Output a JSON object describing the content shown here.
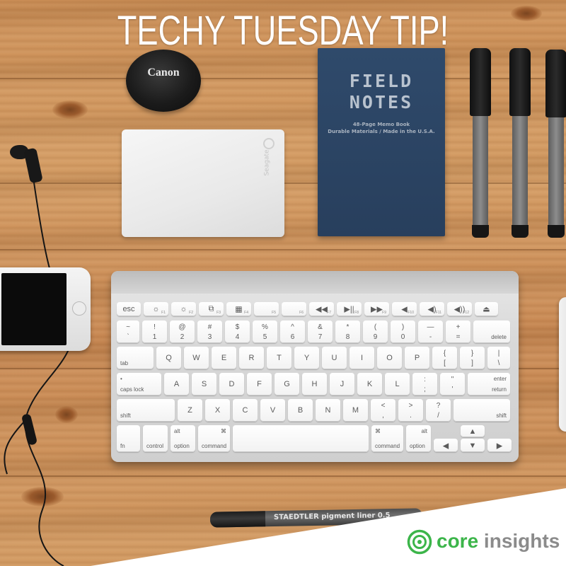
{
  "headline": "TECHY TUESDAY TIP!",
  "lens_cap": {
    "brand": "Canon"
  },
  "hard_drive": {
    "logo_text": "Seagate"
  },
  "notebook": {
    "title": "FIELD\nNOTES",
    "subtitle": "48-Page Memo Book\nDurable Materials / Made in the U.S.A."
  },
  "staedtler": {
    "text": "STAEDTLER  pigment liner  0.5"
  },
  "brand": {
    "word1": "core",
    "word2": " insights",
    "accent_color": "#3cb54a",
    "gray_color": "#8b8b8b"
  },
  "keyboard": {
    "fn_row": [
      {
        "name": "esc",
        "mid": "esc",
        "w": 34
      },
      {
        "name": "f1",
        "mid": "☼",
        "fn": "F1",
        "w": 35
      },
      {
        "name": "f2",
        "mid": "☼",
        "fn": "F2",
        "w": 35
      },
      {
        "name": "f3",
        "mid": "⧉",
        "fn": "F3",
        "w": 35
      },
      {
        "name": "f4",
        "mid": "▦",
        "fn": "F4",
        "w": 35
      },
      {
        "name": "f5",
        "mid": "",
        "fn": "F5",
        "w": 35
      },
      {
        "name": "f6",
        "mid": "",
        "fn": "F6",
        "w": 35
      },
      {
        "name": "f7",
        "mid": "◀◀",
        "fn": "F7",
        "w": 35
      },
      {
        "name": "f8",
        "mid": "▶||",
        "fn": "F8",
        "w": 35
      },
      {
        "name": "f9",
        "mid": "▶▶",
        "fn": "F9",
        "w": 35
      },
      {
        "name": "f10",
        "mid": "◀",
        "fn": "F10",
        "w": 35
      },
      {
        "name": "f11",
        "mid": "◀)",
        "fn": "F11",
        "w": 35
      },
      {
        "name": "f12",
        "mid": "◀))",
        "fn": "F12",
        "w": 35
      },
      {
        "name": "eject",
        "mid": "⏏",
        "w": 33
      }
    ],
    "num_row": [
      {
        "name": "tilde",
        "t": "~",
        "b": "`",
        "w": 32
      },
      {
        "name": "1",
        "t": "!",
        "b": "1",
        "w": 35
      },
      {
        "name": "2",
        "t": "@",
        "b": "2",
        "w": 35
      },
      {
        "name": "3",
        "t": "#",
        "b": "3",
        "w": 35
      },
      {
        "name": "4",
        "t": "$",
        "b": "4",
        "w": 35
      },
      {
        "name": "5",
        "t": "%",
        "b": "5",
        "w": 35
      },
      {
        "name": "6",
        "t": "^",
        "b": "6",
        "w": 35
      },
      {
        "name": "7",
        "t": "&",
        "b": "7",
        "w": 35
      },
      {
        "name": "8",
        "t": "*",
        "b": "8",
        "w": 35
      },
      {
        "name": "9",
        "t": "(",
        "b": "9",
        "w": 35
      },
      {
        "name": "0",
        "t": ")",
        "b": "0",
        "w": 35
      },
      {
        "name": "minus",
        "t": "—",
        "b": "-",
        "w": 35
      },
      {
        "name": "equals",
        "t": "+",
        "b": "=",
        "w": 35
      },
      {
        "name": "delete",
        "br": "delete",
        "w": 52
      }
    ],
    "qwerty_row": [
      {
        "name": "tab",
        "bl": "tab",
        "w": 52
      },
      {
        "name": "q",
        "mid": "Q",
        "w": 35
      },
      {
        "name": "w",
        "mid": "W",
        "w": 35
      },
      {
        "name": "e",
        "mid": "E",
        "w": 35
      },
      {
        "name": "r",
        "mid": "R",
        "w": 35
      },
      {
        "name": "t",
        "mid": "T",
        "w": 35
      },
      {
        "name": "y",
        "mid": "Y",
        "w": 35
      },
      {
        "name": "u",
        "mid": "U",
        "w": 35
      },
      {
        "name": "i",
        "mid": "I",
        "w": 35
      },
      {
        "name": "o",
        "mid": "O",
        "w": 35
      },
      {
        "name": "p",
        "mid": "P",
        "w": 35
      },
      {
        "name": "lbracket",
        "t": "{",
        "b": "[",
        "w": 35
      },
      {
        "name": "rbracket",
        "t": "}",
        "b": "]",
        "w": 35
      },
      {
        "name": "backslash",
        "t": "|",
        "b": "\\",
        "w": 32
      }
    ],
    "home_row": [
      {
        "name": "caps-lock",
        "bl": "caps lock",
        "tl": "•",
        "w": 63
      },
      {
        "name": "a",
        "mid": "A",
        "w": 35
      },
      {
        "name": "s",
        "mid": "S",
        "w": 35
      },
      {
        "name": "d",
        "mid": "D",
        "w": 35
      },
      {
        "name": "f",
        "mid": "F",
        "w": 35
      },
      {
        "name": "g",
        "mid": "G",
        "w": 35
      },
      {
        "name": "h",
        "mid": "H",
        "w": 35
      },
      {
        "name": "j",
        "mid": "J",
        "w": 35
      },
      {
        "name": "k",
        "mid": "K",
        "w": 35
      },
      {
        "name": "l",
        "mid": "L",
        "w": 35
      },
      {
        "name": "semicolon",
        "t": ":",
        "b": ";",
        "w": 35
      },
      {
        "name": "quote",
        "t": "\"",
        "b": "'",
        "w": 35
      },
      {
        "name": "return",
        "tr": "enter",
        "br": "return",
        "w": 60
      }
    ],
    "shift_row": [
      {
        "name": "left-shift",
        "bl": "shift",
        "w": 82
      },
      {
        "name": "z",
        "mid": "Z",
        "w": 35
      },
      {
        "name": "x",
        "mid": "X",
        "w": 35
      },
      {
        "name": "c",
        "mid": "C",
        "w": 35
      },
      {
        "name": "v",
        "mid": "V",
        "w": 35
      },
      {
        "name": "b",
        "mid": "B",
        "w": 35
      },
      {
        "name": "n",
        "mid": "N",
        "w": 35
      },
      {
        "name": "m",
        "mid": "M",
        "w": 35
      },
      {
        "name": "comma",
        "t": "<",
        "b": ",",
        "w": 35
      },
      {
        "name": "period",
        "t": ">",
        "b": ".",
        "w": 35
      },
      {
        "name": "slash",
        "t": "?",
        "b": "/",
        "w": 35
      },
      {
        "name": "right-shift",
        "br": "shift",
        "w": 80
      }
    ],
    "bottom_row": [
      {
        "name": "fn",
        "bl": "fn",
        "w": 33
      },
      {
        "name": "control",
        "bl": "control",
        "w": 35
      },
      {
        "name": "left-option",
        "tl": "alt",
        "bl": "option",
        "w": 35
      },
      {
        "name": "left-command",
        "tr": "⌘",
        "bl": "command",
        "w": 45
      },
      {
        "name": "space",
        "w": 192
      },
      {
        "name": "right-command",
        "tl": "⌘",
        "bl": "command",
        "w": 45
      },
      {
        "name": "right-option",
        "tr": "alt",
        "bl": "option",
        "w": 35
      }
    ],
    "arrows": {
      "up": "▲",
      "left": "◀",
      "down": "▼",
      "right": "▶"
    }
  }
}
